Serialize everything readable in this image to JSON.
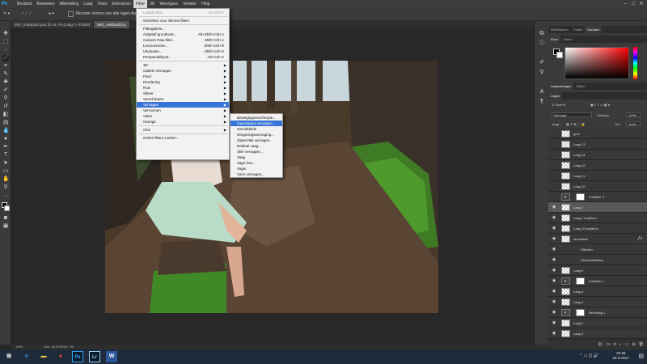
{
  "app": {
    "logo": "Ps"
  },
  "menubar": {
    "items": [
      "Bestand",
      "Bewerken",
      "Afbeelding",
      "Laag",
      "Tekst",
      "Selecteren",
      "Filter",
      "3D",
      "Weergave",
      "Venster",
      "Help"
    ],
    "active_index": 6
  },
  "options": {
    "checkbox_label": "Monster nemen van alle lagen",
    "auto_label": "Au"
  },
  "tabs": [
    {
      "label": "IMG_5480psd2.psd @ 16,7% (Laag 0, RGB/8)",
      "active": false
    },
    {
      "label": "IMG_5480psd1l.p",
      "active": true
    }
  ],
  "filter_menu": [
    {
      "label": "Laatste filter",
      "shortcut": "Alt+Ctrl+F",
      "disabled": true
    },
    {
      "separator": true
    },
    {
      "label": "Omzetten voor slimme filters"
    },
    {
      "separator": true
    },
    {
      "label": "Filtergalerie..."
    },
    {
      "label": "Adaptief groothoek...",
      "shortcut": "Alt+Shift+Ctrl+A"
    },
    {
      "label": "Camera Raw-filter...",
      "shortcut": "Shift+Ctrl+A"
    },
    {
      "label": "Lenscorrectie...",
      "shortcut": "Shift+Ctrl+R"
    },
    {
      "label": "Uitvloeien...",
      "shortcut": "Shift+Ctrl+X"
    },
    {
      "label": "Perspectiefpunt...",
      "shortcut": "Alt+Ctrl+V"
    },
    {
      "separator": true
    },
    {
      "label": "3D",
      "submenu": true
    },
    {
      "label": "Galerie Vervagen",
      "submenu": true
    },
    {
      "label": "Pixel",
      "submenu": true
    },
    {
      "label": "Rendering",
      "submenu": true
    },
    {
      "label": "Ruis",
      "submenu": true
    },
    {
      "label": "Stileer",
      "submenu": true
    },
    {
      "label": "Verscherpen",
      "submenu": true
    },
    {
      "label": "Vervagen",
      "submenu": true,
      "highlighted": true
    },
    {
      "label": "Vervormen",
      "submenu": true
    },
    {
      "label": "Video",
      "submenu": true
    },
    {
      "label": "Overige",
      "submenu": true
    },
    {
      "separator": true
    },
    {
      "label": "ON1",
      "submenu": true
    },
    {
      "separator": true
    },
    {
      "label": "Online filters zoeken..."
    }
  ],
  "blur_submenu": [
    {
      "label": "Bewegingsonscherpte..."
    },
    {
      "label": "Gaussiaans vervagen...",
      "highlighted": true
    },
    {
      "label": "Gemiddelde"
    },
    {
      "label": "Omgevingsvervaging..."
    },
    {
      "label": "Oppervlak vervagen..."
    },
    {
      "label": "Radiaal vaag..."
    },
    {
      "label": "Slim vervagen..."
    },
    {
      "label": "Vaag"
    },
    {
      "label": "Vage lens..."
    },
    {
      "label": "Vager"
    },
    {
      "label": "Vorm vervagen..."
    }
  ],
  "color_panel": {
    "tabs": [
      "Kleur",
      "Stalen"
    ],
    "foreground": "#000000",
    "background": "#ffffff"
  },
  "top_panel_tabs": [
    "Bibliotheken",
    "Paden",
    "Kanalen"
  ],
  "adjust_tabs": [
    "Aanpassingen",
    "Stijlen"
  ],
  "layers_panel": {
    "tab": "Lagen",
    "kind_label": "Soort",
    "blend_mode": "Normaal",
    "opacity_label": "Dekking:",
    "opacity_value": "100%",
    "lock_label": "Vergr.:",
    "fill_label": "Vul:",
    "fill_value": "100%",
    "layers": [
      {
        "name": "grov",
        "visible": false,
        "type": "pixel"
      },
      {
        "name": "Laag 13",
        "visible": false,
        "type": "pixel"
      },
      {
        "name": "Laag 14",
        "visible": false,
        "type": "pixel"
      },
      {
        "name": "Laag 12",
        "visible": false,
        "type": "pixel"
      },
      {
        "name": "Laag 11",
        "visible": false,
        "type": "pixel"
      },
      {
        "name": "Laag 10",
        "visible": false,
        "type": "pixel"
      },
      {
        "name": "Fotofilter 3",
        "visible": false,
        "type": "adjustment"
      },
      {
        "name": "Laag 7",
        "visible": true,
        "type": "pixel",
        "selected": true
      },
      {
        "name": "Laag 2 kopiëren",
        "visible": true,
        "type": "pixel"
      },
      {
        "name": "Laag 10 kopiëren",
        "visible": true,
        "type": "pixel"
      },
      {
        "name": "knodebad",
        "visible": true,
        "type": "pixel",
        "fx": true
      },
      {
        "name": "Effecten",
        "visible": true,
        "type": "effect"
      },
      {
        "name": "Kleurbedekking",
        "visible": true,
        "type": "effect"
      },
      {
        "name": "Laag 9",
        "visible": true,
        "type": "pixel"
      },
      {
        "name": "Fotofilter 1",
        "visible": true,
        "type": "adjustment"
      },
      {
        "name": "Laag 4",
        "visible": true,
        "type": "pixel"
      },
      {
        "name": "Laag 3",
        "visible": true,
        "type": "pixel"
      },
      {
        "name": "Belichting 1",
        "visible": true,
        "type": "adjustment"
      },
      {
        "name": "Laag 2",
        "visible": true,
        "type": "pixel"
      },
      {
        "name": "Laag 5",
        "visible": true,
        "type": "pixel"
      }
    ],
    "footer_icons": [
      "link-icon",
      "fx-icon",
      "mask-icon",
      "adjustment-icon",
      "folder-icon",
      "new-layer-icon",
      "trash-icon"
    ]
  },
  "status": {
    "zoom": "20%",
    "doc": "Doc: 34,5 M/233,7 M"
  },
  "taskbar": {
    "apps": [
      {
        "name": "start",
        "glyph": "⊞",
        "color": "#ffffff"
      },
      {
        "name": "ie",
        "glyph": "e",
        "color": "#2f8de4"
      },
      {
        "name": "explorer",
        "glyph": "▬",
        "color": "#e8c34a"
      },
      {
        "name": "chrome",
        "glyph": "●",
        "color": "#e44b35"
      },
      {
        "name": "photoshop",
        "glyph": "Ps",
        "color": "#31a8ff"
      },
      {
        "name": "lightroom",
        "glyph": "Lr",
        "color": "#9ad1f5"
      },
      {
        "name": "word",
        "glyph": "W",
        "color": "#2b579a"
      }
    ],
    "time": "20:36",
    "date": "24-3-2017"
  }
}
